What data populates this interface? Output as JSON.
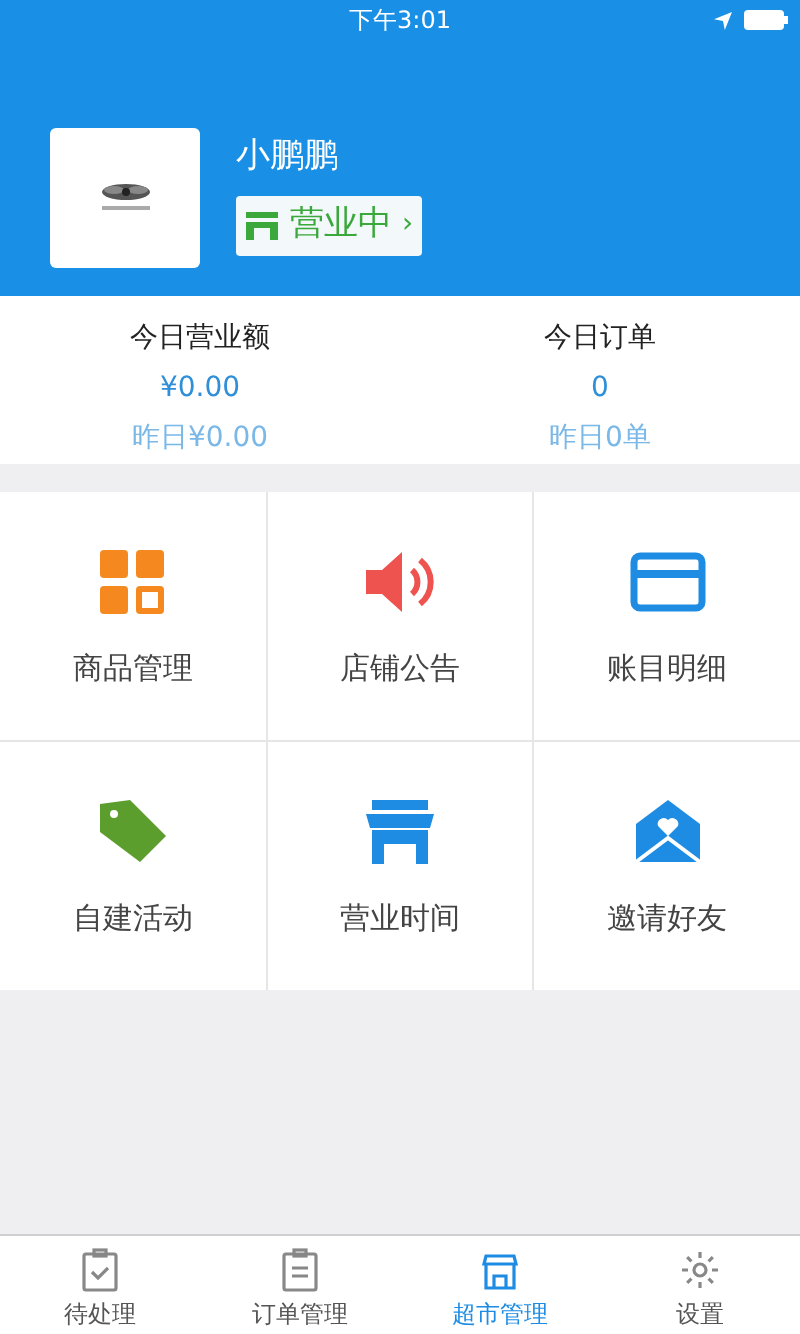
{
  "status_bar": {
    "time": "下午3:01"
  },
  "store": {
    "name": "小鹏鹏",
    "status": "营业中",
    "chevron": "›"
  },
  "stats": [
    {
      "label": "今日营业额",
      "value": "¥0.00",
      "yesterday": "昨日¥0.00"
    },
    {
      "label": "今日订单",
      "value": "0",
      "yesterday": "昨日0单"
    }
  ],
  "menu": [
    {
      "label": "商品管理",
      "color": "#f5891f"
    },
    {
      "label": "店铺公告",
      "color": "#ef5350"
    },
    {
      "label": "账目明细",
      "color": "#1e8ce3"
    },
    {
      "label": "自建活动",
      "color": "#5b9e2e"
    },
    {
      "label": "营业时间",
      "color": "#1e8ce3"
    },
    {
      "label": "邀请好友",
      "color": "#1e8ce3"
    }
  ],
  "tab_bar": [
    {
      "label": "待处理",
      "selected": false
    },
    {
      "label": "订单管理",
      "selected": false
    },
    {
      "label": "超市管理",
      "selected": true
    },
    {
      "label": "设置",
      "selected": false
    }
  ]
}
